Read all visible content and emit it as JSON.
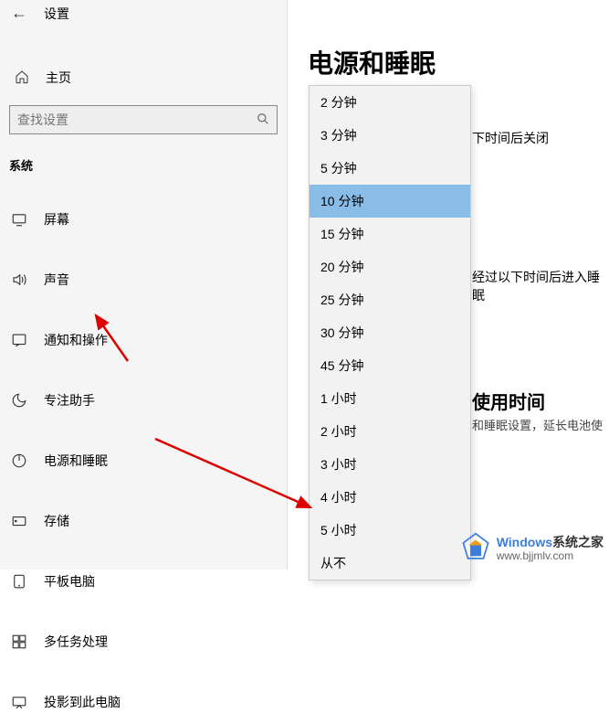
{
  "header": {
    "title": "设置"
  },
  "home": {
    "label": "主页"
  },
  "search": {
    "placeholder": "查找设置"
  },
  "section": {
    "label": "系统"
  },
  "nav": {
    "items": [
      {
        "label": "屏幕"
      },
      {
        "label": "声音"
      },
      {
        "label": "通知和操作"
      },
      {
        "label": "专注助手"
      },
      {
        "label": "电源和睡眠"
      },
      {
        "label": "存储"
      },
      {
        "label": "平板电脑"
      },
      {
        "label": "多任务处理"
      },
      {
        "label": "投影到此电脑"
      }
    ]
  },
  "page": {
    "title": "电源和睡眠",
    "desc1_partial": "下时间后关闭",
    "desc2_partial": "经过以下时间后进入睡眠",
    "section_title_partial": "使用时间",
    "hint_partial": "和睡眠设置，延长电池使"
  },
  "dropdown": {
    "options": [
      "2 分钟",
      "3 分钟",
      "5 分钟",
      "10 分钟",
      "15 分钟",
      "20 分钟",
      "25 分钟",
      "30 分钟",
      "45 分钟",
      "1 小时",
      "2 小时",
      "3 小时",
      "4 小时",
      "5 小时",
      "从不"
    ],
    "selected_index": 3
  },
  "watermark": {
    "brand_en": "Windows",
    "brand_cn": "系统之家",
    "url": "www.bjjmlv.com"
  }
}
